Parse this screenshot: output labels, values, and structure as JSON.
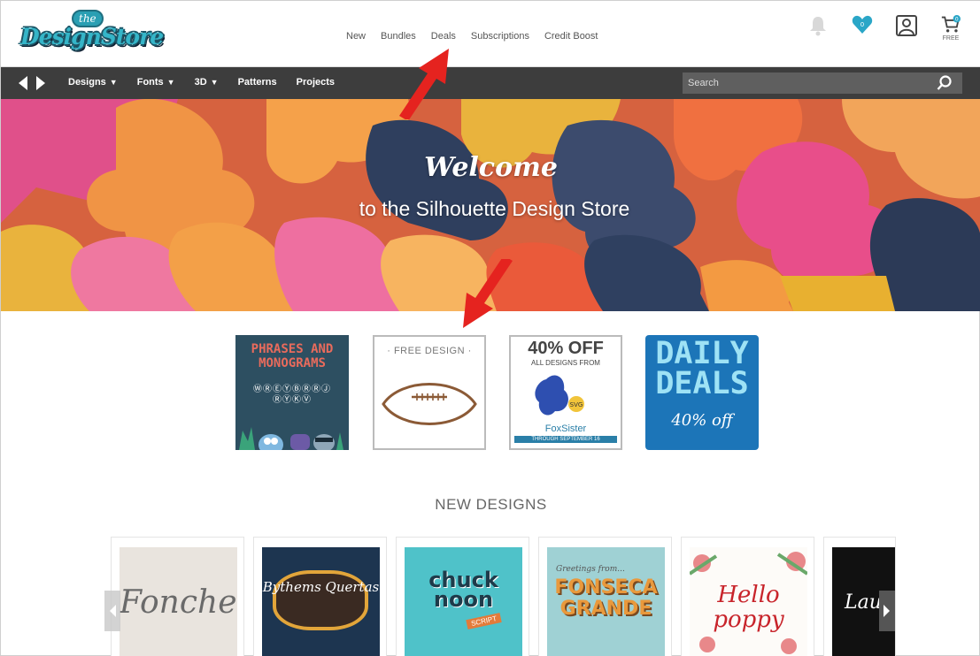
{
  "header": {
    "logo_small": "the",
    "logo_text": "DesignStore",
    "nav": [
      "New",
      "Bundles",
      "Deals",
      "Subscriptions",
      "Credit Boost"
    ],
    "cart_label": "FREE"
  },
  "navbar": {
    "menu": [
      {
        "label": "Designs",
        "dropdown": true
      },
      {
        "label": "Fonts",
        "dropdown": true
      },
      {
        "label": "3D",
        "dropdown": true
      },
      {
        "label": "Patterns",
        "dropdown": false
      },
      {
        "label": "Projects",
        "dropdown": false
      }
    ],
    "search_placeholder": "Search"
  },
  "banner": {
    "title": "Welcome",
    "subtitle": "to the Silhouette Design Store"
  },
  "promos": {
    "phrases": {
      "line1": "PHRASES AND",
      "line2": "MONOGRAMS",
      "line3": "ⓌⓇⒺⓎⒷⓇⓇⒿ",
      "line4": "ⓇⓎⓀⓋ"
    },
    "free": {
      "title": "· FREE DESIGN ·"
    },
    "sale": {
      "title": "40% OFF",
      "sub": "ALL DESIGNS FROM",
      "brand": "FoxSister",
      "through": "THROUGH SEPTEMBER 16"
    },
    "daily": {
      "title": "DAILY DEALS",
      "sub": "40% off"
    }
  },
  "new_designs": {
    "title": "NEW DESIGNS",
    "cards": [
      {
        "text": "Foncher"
      },
      {
        "text": "Bythems Quertas"
      },
      {
        "text": "chuck noon",
        "tag": "SCRIPT"
      },
      {
        "small": "Greetings from...",
        "text": "FONSECA GRANDE"
      },
      {
        "text": "Hello poppy"
      },
      {
        "text": "Lau"
      }
    ]
  },
  "colors": {
    "navbar_bg": "#3d3d3d",
    "accent_teal": "#35b5c8",
    "arrow_red": "#e5231f"
  }
}
